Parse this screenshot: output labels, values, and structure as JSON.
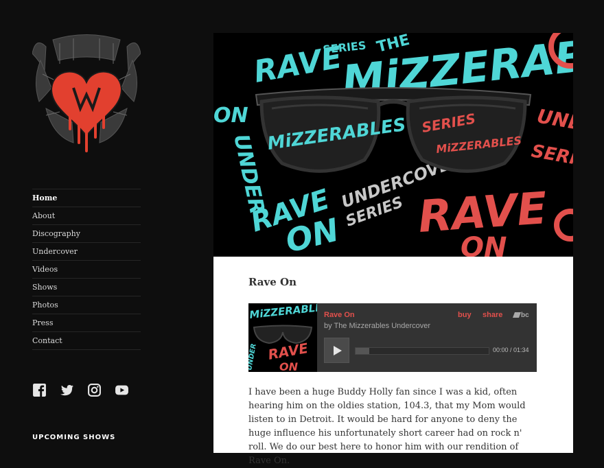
{
  "nav": {
    "items": [
      {
        "label": "Home",
        "current": true
      },
      {
        "label": "About"
      },
      {
        "label": "Discography"
      },
      {
        "label": "Undercover"
      },
      {
        "label": "Videos"
      },
      {
        "label": "Shows"
      },
      {
        "label": "Photos"
      },
      {
        "label": "Press"
      },
      {
        "label": "Contact"
      }
    ]
  },
  "social": [
    "facebook-icon",
    "twitter-icon",
    "instagram-icon",
    "youtube-icon"
  ],
  "widgets": {
    "upcoming_title": "UPCOMING SHOWS"
  },
  "colors": {
    "accent_red": "#e2504c",
    "accent_cyan": "#4fd6d6",
    "background": "#0e0e0e"
  },
  "post": {
    "title": "Rave On",
    "body": "I have been a huge Buddy Holly fan since I was a kid, often hearing him on the oldies station, 104.3, that my Mom would listen to in Detroit. It would be hard for anyone to deny the huge influence his unfortunately short career had on rock n' roll. We do our best here to honor him with our rendition of Rave On."
  },
  "player": {
    "track": "Rave On",
    "artist": "by The Mizzerables Undercover",
    "buy": "buy",
    "share": "share",
    "brand": "bc",
    "time": "00:00 / 01:34",
    "progress": 0
  },
  "hero_text": {
    "rave": "RAVE",
    "on": "ON",
    "series": "SERIES",
    "the": "THE",
    "band": "MiZZERAB",
    "under": "UNDER",
    "undercover": "UNDERCOVE",
    "lens_band": "MiZZERABLES",
    "lens_series": "SERIES"
  }
}
